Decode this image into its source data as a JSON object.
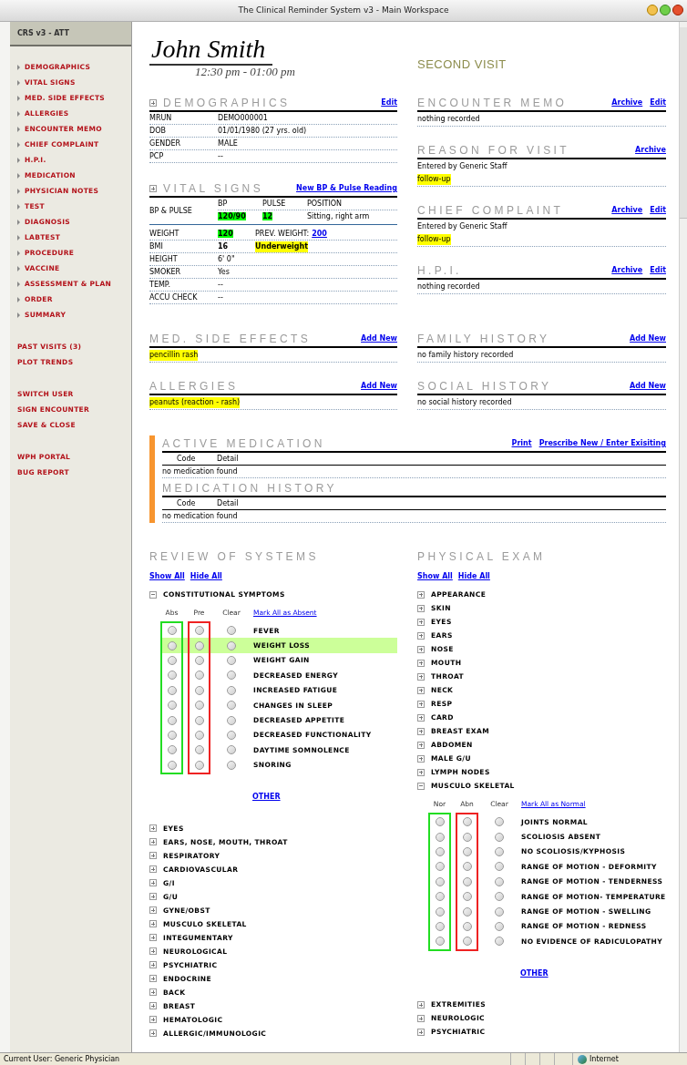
{
  "window": {
    "title": "The Clinical Reminder System v3 - Main Workspace"
  },
  "sidebar": {
    "title": "CRS v3 - ATT",
    "groups": [
      {
        "kind": "sections",
        "items": [
          "DEMOGRAPHICS",
          "VITAL SIGNS",
          "MED. SIDE EFFECTS",
          "ALLERGIES",
          "ENCOUNTER MEMO",
          "CHIEF COMPLAINT",
          "H.P.I.",
          "MEDICATION",
          "PHYSICIAN NOTES",
          "TEST",
          "DIAGNOSIS",
          "LABTEST",
          "PROCEDURE",
          "VACCINE",
          "ASSESSMENT & PLAN",
          "ORDER",
          "SUMMARY"
        ]
      },
      {
        "kind": "actions",
        "items": [
          "PAST VISITS (3)",
          "PLOT TRENDS"
        ]
      },
      {
        "kind": "actions",
        "items": [
          "SWITCH USER",
          "SIGN ENCOUNTER",
          "SAVE & CLOSE"
        ]
      },
      {
        "kind": "actions",
        "items": [
          "WPH PORTAL",
          "BUG REPORT"
        ]
      }
    ]
  },
  "patient": {
    "name": "John Smith",
    "time": "12:30 pm - 01:00 pm",
    "visit": "SECOND VISIT"
  },
  "demographics": {
    "title": "DEMOGRAPHICS",
    "toggle": true,
    "links": [
      "Edit"
    ],
    "rows": [
      {
        "label": "MRUN",
        "value": "DEMO000001"
      },
      {
        "label": "DOB",
        "value": "01/01/1980 (27 yrs. old)"
      },
      {
        "label": "GENDER",
        "value": "MALE"
      },
      {
        "label": "PCP",
        "value": "--"
      }
    ]
  },
  "vital_signs": {
    "title": "VITAL SIGNS",
    "toggle": true,
    "links": [
      "New BP & Pulse Reading"
    ],
    "bp": {
      "label": "BP & PULSE",
      "columns": [
        "BP",
        "PULSE",
        "POSITION"
      ],
      "values": [
        {
          "text": "120/90",
          "color": "#00ff00"
        },
        {
          "text": "12",
          "color": "#00ff00"
        },
        {
          "text": "Sitting, right arm"
        }
      ]
    },
    "rows": [
      {
        "label": "WEIGHT",
        "value": "120",
        "color": "#00ff00",
        "extra_label": "PREV. WEIGHT:",
        "extra_link": "200"
      },
      {
        "label": "BMI",
        "value": "16",
        "bold": true,
        "status": {
          "text": "Underweight",
          "color": "#ffff00"
        }
      },
      {
        "label": "HEIGHT",
        "value": "6' 0\""
      },
      {
        "label": "SMOKER",
        "value": "Yes"
      },
      {
        "label": "TEMP.",
        "value": "--"
      },
      {
        "label": "ACCU CHECK",
        "value": "--"
      }
    ]
  },
  "left_notes": [
    {
      "title": "MED. SIDE EFFECTS",
      "links": [
        "Add New"
      ],
      "lines": [
        {
          "text": "pencillin rash",
          "color": "#ffff00"
        }
      ]
    },
    {
      "title": "ALLERGIES",
      "links": [
        "Add New"
      ],
      "lines": [
        {
          "text": "peanuts (reaction - rash)",
          "color": "#ffff00"
        }
      ]
    }
  ],
  "right_notes": [
    {
      "title": "ENCOUNTER MEMO",
      "links": [
        "Archive",
        "Edit"
      ],
      "lines": [
        {
          "text": "nothing recorded"
        }
      ]
    },
    {
      "title": "REASON FOR VISIT",
      "links": [
        "Archive"
      ],
      "lines": [
        {
          "text": "Entered by Generic Staff"
        },
        {
          "text": "follow-up",
          "color": "#ffff00"
        }
      ]
    },
    {
      "title": "CHIEF COMPLAINT",
      "links": [
        "Archive",
        "Edit"
      ],
      "lines": [
        {
          "text": "Entered by Generic Staff"
        },
        {
          "text": "follow-up",
          "color": "#ffff00"
        }
      ]
    },
    {
      "title": "H.P.I.",
      "links": [
        "Archive",
        "Edit"
      ],
      "lines": [
        {
          "text": "nothing recorded"
        }
      ]
    }
  ],
  "history_notes": [
    {
      "title": "FAMILY HISTORY",
      "links": [
        "Add New"
      ],
      "lines": [
        {
          "text": "no family history recorded"
        }
      ]
    },
    {
      "title": "SOCIAL HISTORY",
      "links": [
        "Add New"
      ],
      "lines": [
        {
          "text": "no social history recorded"
        }
      ]
    }
  ],
  "medication": [
    {
      "title": "ACTIVE MEDICATION",
      "links": [
        "Print",
        "Prescribe New / Enter Exisiting"
      ],
      "columns": [
        "Code",
        "Detail"
      ],
      "empty": "no medication found"
    },
    {
      "title": "MEDICATION HISTORY",
      "columns": [
        "Code",
        "Detail"
      ],
      "empty": "no medication found"
    }
  ],
  "review_of_systems": {
    "title": "REVIEW OF SYSTEMS",
    "links": [
      "Show All",
      "Hide All"
    ],
    "items": [
      {
        "label": "CONSTITUTIONAL SYMPTOMS",
        "expanded": true,
        "columns": [
          "Abs",
          "Pre",
          "Clear"
        ],
        "mark_all": "Mark All as Absent",
        "other": "OTHER",
        "rows": [
          {
            "label": "FEVER",
            "highlighted": false,
            "checked": [
              false,
              false,
              false
            ]
          },
          {
            "label": "WEIGHT LOSS",
            "highlighted": true,
            "checked": [
              false,
              false,
              false
            ]
          },
          {
            "label": "WEIGHT GAIN",
            "highlighted": false,
            "checked": [
              false,
              false,
              false
            ]
          },
          {
            "label": "DECREASED ENERGY",
            "highlighted": false,
            "checked": [
              false,
              false,
              false
            ]
          },
          {
            "label": "INCREASED FATIGUE",
            "highlighted": false,
            "checked": [
              false,
              false,
              false
            ]
          },
          {
            "label": "CHANGES IN SLEEP",
            "highlighted": false,
            "checked": [
              false,
              false,
              false
            ]
          },
          {
            "label": "DECREASED APPETITE",
            "highlighted": false,
            "checked": [
              false,
              false,
              false
            ]
          },
          {
            "label": "DECREASED FUNCTIONALITY",
            "highlighted": false,
            "checked": [
              false,
              false,
              false
            ]
          },
          {
            "label": "DAYTIME SOMNOLENCE",
            "highlighted": false,
            "checked": [
              false,
              false,
              false
            ]
          },
          {
            "label": "SNORING",
            "highlighted": false,
            "checked": [
              false,
              false,
              false
            ]
          }
        ]
      },
      {
        "label": "EYES",
        "expanded": false
      },
      {
        "label": "EARS, NOSE, MOUTH, THROAT",
        "expanded": false
      },
      {
        "label": "RESPIRATORY",
        "expanded": false
      },
      {
        "label": "CARDIOVASCULAR",
        "expanded": false
      },
      {
        "label": "G/I",
        "expanded": false
      },
      {
        "label": "G/U",
        "expanded": false
      },
      {
        "label": "GYNE/OBST",
        "expanded": false
      },
      {
        "label": "MUSCULO SKELETAL",
        "expanded": false
      },
      {
        "label": "INTEGUMENTARY",
        "expanded": false
      },
      {
        "label": "NEUROLOGICAL",
        "expanded": false
      },
      {
        "label": "PSYCHIATRIC",
        "expanded": false
      },
      {
        "label": "ENDOCRINE",
        "expanded": false
      },
      {
        "label": "BACK",
        "expanded": false
      },
      {
        "label": "BREAST",
        "expanded": false
      },
      {
        "label": "HEMATOLOGIC",
        "expanded": false
      },
      {
        "label": "ALLERGIC/IMMUNOLOGIC",
        "expanded": false
      }
    ]
  },
  "physical_exam": {
    "title": "PHYSICAL EXAM",
    "links": [
      "Show All",
      "Hide All"
    ],
    "items": [
      {
        "label": "APPEARANCE",
        "expanded": false
      },
      {
        "label": "SKIN",
        "expanded": false
      },
      {
        "label": "EYES",
        "expanded": false
      },
      {
        "label": "EARS",
        "expanded": false
      },
      {
        "label": "NOSE",
        "expanded": false
      },
      {
        "label": "MOUTH",
        "expanded": false
      },
      {
        "label": "THROAT",
        "expanded": false
      },
      {
        "label": "NECK",
        "expanded": false
      },
      {
        "label": "RESP",
        "expanded": false
      },
      {
        "label": "CARD",
        "expanded": false
      },
      {
        "label": "BREAST EXAM",
        "expanded": false
      },
      {
        "label": "ABDOMEN",
        "expanded": false
      },
      {
        "label": "MALE G/U",
        "expanded": false
      },
      {
        "label": "LYMPH NODES",
        "expanded": false
      },
      {
        "label": "MUSCULO SKELETAL",
        "expanded": true,
        "columns": [
          "Nor",
          "Abn",
          "Clear"
        ],
        "mark_all": "Mark All as Normal",
        "other": "OTHER",
        "rows": [
          {
            "label": "JOINTS NORMAL",
            "highlighted": false,
            "checked": [
              false,
              false,
              false
            ]
          },
          {
            "label": "SCOLIOSIS ABSENT",
            "highlighted": false,
            "checked": [
              false,
              false,
              false
            ]
          },
          {
            "label": "NO SCOLIOSIS/KYPHOSIS",
            "highlighted": false,
            "checked": [
              false,
              false,
              false
            ]
          },
          {
            "label": "RANGE OF MOTION - DEFORMITY",
            "highlighted": false,
            "checked": [
              false,
              false,
              false
            ]
          },
          {
            "label": "RANGE OF MOTION - TENDERNESS",
            "highlighted": false,
            "checked": [
              false,
              false,
              false
            ]
          },
          {
            "label": "RANGE OF MOTION- TEMPERATURE",
            "highlighted": false,
            "checked": [
              false,
              false,
              false
            ]
          },
          {
            "label": "RANGE OF MOTION - SWELLING",
            "highlighted": false,
            "checked": [
              false,
              false,
              false
            ]
          },
          {
            "label": "RANGE OF MOTION - REDNESS",
            "highlighted": false,
            "checked": [
              false,
              false,
              false
            ]
          },
          {
            "label": "NO EVIDENCE OF RADICULOPATHY",
            "highlighted": false,
            "checked": [
              false,
              false,
              false
            ]
          }
        ]
      },
      {
        "label": "EXTREMITIES",
        "expanded": false
      },
      {
        "label": "NEUROLOGIC",
        "expanded": false
      },
      {
        "label": "PSYCHIATRIC",
        "expanded": false
      }
    ]
  },
  "status_bar": {
    "user": "Current User: Generic Physician",
    "zone": "Internet"
  }
}
